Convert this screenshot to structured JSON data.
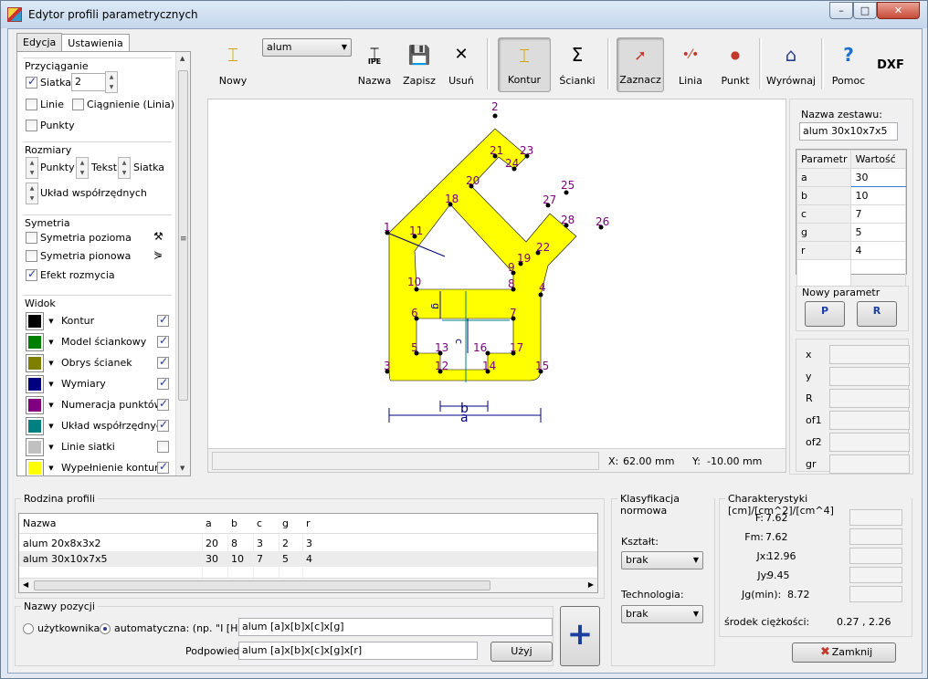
{
  "window": {
    "title": "Edytor profili parametrycznych",
    "min": "–",
    "max": "□",
    "close": "✕"
  },
  "tabs": [
    {
      "label": "Edycja"
    },
    {
      "label": "Ustawienia"
    }
  ],
  "settings": {
    "snap": {
      "title": "Przyciąganie",
      "grid_label": "Siatka",
      "grid_value": "2",
      "lines_label": "Linie",
      "drag_label": "Ciągnienie (Linia)",
      "points_label": "Punkty"
    },
    "sizes": {
      "title": "Rozmiary",
      "points": "Punkty",
      "text": "Tekst",
      "grid": "Siatka",
      "coords": "Układ współrzędnych"
    },
    "symmetry": {
      "title": "Symetria",
      "horizontal": "Symetria pozioma",
      "vertical": "Symetria pionowa",
      "mirror": "Efekt rozmycia"
    },
    "view": {
      "title": "Widok",
      "items": [
        {
          "label": "Kontur",
          "color": "#000000",
          "checked": true
        },
        {
          "label": "Model ściankowy",
          "color": "#008000",
          "checked": true
        },
        {
          "label": "Obrys ścianek",
          "color": "#808000",
          "checked": true
        },
        {
          "label": "Wymiary",
          "color": "#000080",
          "checked": true
        },
        {
          "label": "Numeracja punktów",
          "color": "#800080",
          "checked": true
        },
        {
          "label": "Układ współrzędnych",
          "color": "#008080",
          "checked": true
        },
        {
          "label": "Linie siatki",
          "color": "#c0c0c0",
          "checked": false
        },
        {
          "label": "Wypełnienie konturu",
          "color": "#ffff00",
          "checked": true
        }
      ]
    }
  },
  "toolbar": {
    "new": "Nowy",
    "profile_select": "alum",
    "name": "Nazwa",
    "save": "Zapisz",
    "delete": "Usuń",
    "contour": "Kontur",
    "walls": "Ścianki",
    "select": "Zaznacz",
    "line": "Linia",
    "point": "Punkt",
    "align": "Wyrównaj",
    "help": "Pomoc",
    "dxf": "DXF",
    "ipe_label": "IPE"
  },
  "coords": {
    "x_label": "X:",
    "x_value": "62.00 mm",
    "y_label": "Y:",
    "y_value": "-10.00 mm"
  },
  "drawing": {
    "points": [
      {
        "n": "1"
      },
      {
        "n": "2"
      },
      {
        "n": "3"
      },
      {
        "n": "4"
      },
      {
        "n": "5"
      },
      {
        "n": "6"
      },
      {
        "n": "7"
      },
      {
        "n": "8"
      },
      {
        "n": "9"
      },
      {
        "n": "10"
      },
      {
        "n": "11"
      },
      {
        "n": "12"
      },
      {
        "n": "13"
      },
      {
        "n": "14"
      },
      {
        "n": "15"
      },
      {
        "n": "16"
      },
      {
        "n": "17"
      },
      {
        "n": "18"
      },
      {
        "n": "19"
      },
      {
        "n": "20"
      },
      {
        "n": "21"
      },
      {
        "n": "22"
      },
      {
        "n": "23"
      },
      {
        "n": "24"
      },
      {
        "n": "25"
      },
      {
        "n": "26"
      },
      {
        "n": "27"
      },
      {
        "n": "28"
      }
    ],
    "dim_a": "a",
    "dim_b": "b",
    "dim_c": "c",
    "dim_g": "g"
  },
  "params": {
    "set_name_label": "Nazwa zestawu:",
    "set_name": "alum 30x10x7x5",
    "col_param": "Parametr",
    "col_value": "Wartość",
    "rows": [
      {
        "p": "a",
        "v": "30"
      },
      {
        "p": "b",
        "v": "10"
      },
      {
        "p": "c",
        "v": "7"
      },
      {
        "p": "g",
        "v": "5"
      },
      {
        "p": "r",
        "v": "4"
      }
    ],
    "new_param": "Nowy parametr",
    "btn_p": "P",
    "btn_r": "R"
  },
  "fields": [
    {
      "label": "x"
    },
    {
      "label": "y"
    },
    {
      "label": "R"
    },
    {
      "label": "of1"
    },
    {
      "label": "of2"
    },
    {
      "label": "gr"
    }
  ],
  "family": {
    "title": "Rodzina profili",
    "headers": [
      "Nazwa",
      "a",
      "b",
      "c",
      "g",
      "r"
    ],
    "rows": [
      [
        "alum 20x8x3x2",
        "20",
        "8",
        "3",
        "2",
        "3"
      ],
      [
        "alum 30x10x7x5",
        "30",
        "10",
        "7",
        "5",
        "4"
      ]
    ]
  },
  "positions": {
    "title": "Nazwy pozycji",
    "user": "użytkownika",
    "auto": "automatyczna: (np. \"I [H]\")",
    "auto_value": "alum [a]x[b]x[c]x[g]",
    "hint_label": "Podpowiedź",
    "hint_value": "alum [a]x[b]x[c]x[g]x[r]",
    "use": "Użyj"
  },
  "classification": {
    "title": "Klasyfikacja normowa",
    "shape_label": "Kształt:",
    "shape_value": "brak",
    "tech_label": "Technologia:",
    "tech_value": "brak"
  },
  "characteristics": {
    "title": "Charakterystyki [cm]/[cm^2]/[cm^4]",
    "items": [
      {
        "k": "F:",
        "v": "7.62"
      },
      {
        "k": "Fm:",
        "v": "7.62"
      },
      {
        "k": "Jx:",
        "v": "12.96"
      },
      {
        "k": "Jy:",
        "v": "9.45"
      },
      {
        "k": "Jg(min):",
        "v": "8.72"
      }
    ],
    "centroid_label": "środek ciężkości:",
    "centroid_value": "0.27 , 2.26"
  },
  "close_btn": "Zamknij"
}
